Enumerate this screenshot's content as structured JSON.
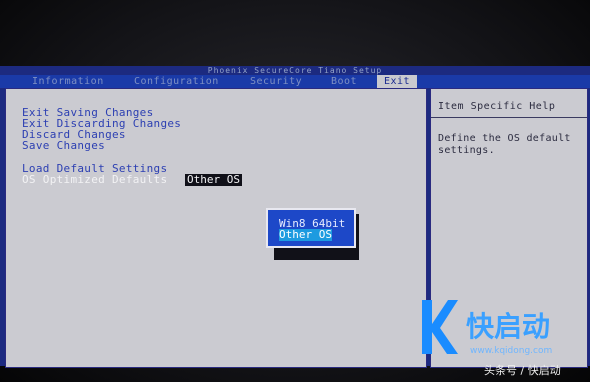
{
  "bios": {
    "title": "Phoenix SecureCore Tiano Setup",
    "menu": [
      {
        "label": "Information",
        "active": false
      },
      {
        "label": "Configuration",
        "active": false
      },
      {
        "label": "Security",
        "active": false
      },
      {
        "label": "Boot",
        "active": false
      },
      {
        "label": "Exit",
        "active": true
      }
    ],
    "exit_items": [
      {
        "label": "Exit Saving Changes"
      },
      {
        "label": "Exit Discarding Changes"
      },
      {
        "label": "Discard Changes"
      },
      {
        "label": "Save Changes"
      },
      {
        "label": "Load Default Settings"
      },
      {
        "label": "OS Optimized Defaults",
        "value": "Other OS"
      }
    ],
    "help": {
      "title": "Item Specific Help",
      "text": "Define the OS default settings."
    },
    "popup": {
      "options": [
        "Win8 64bit",
        "Other OS"
      ],
      "selected": "Other OS"
    }
  },
  "watermark": {
    "brand": "快启动",
    "url": "www.kqidong.com",
    "source": "头条号 / 快启动"
  },
  "colors": {
    "bios_blue": "#1c2a80",
    "panel_gray": "#cbcbd1",
    "item_text": "#2c3fb2",
    "popup_blue": "#1d48c8",
    "brand_blue": "#3aa0ff"
  }
}
